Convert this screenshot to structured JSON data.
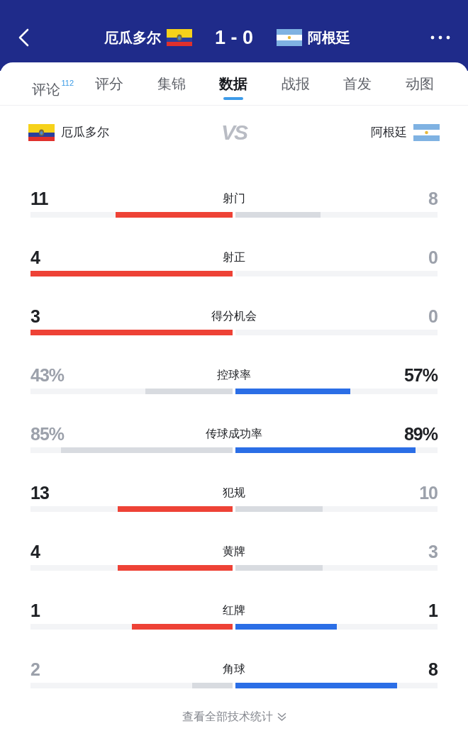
{
  "header": {
    "home_team": "厄瓜多尔",
    "score": "1 - 0",
    "away_team": "阿根廷"
  },
  "tabs": [
    {
      "label": "评论",
      "badge": "112",
      "selected": false
    },
    {
      "label": "评分",
      "selected": false
    },
    {
      "label": "集锦",
      "selected": false
    },
    {
      "label": "数据",
      "selected": true
    },
    {
      "label": "战报",
      "selected": false
    },
    {
      "label": "首发",
      "selected": false
    },
    {
      "label": "动图",
      "selected": false
    }
  ],
  "teams": {
    "home": "厄瓜多尔",
    "vs": "VS",
    "away": "阿根廷"
  },
  "stats": [
    {
      "label": "射门",
      "home": {
        "value": "11",
        "level": 0.58,
        "leading": true
      },
      "away": {
        "value": "8",
        "level": 0.42,
        "leading": false
      }
    },
    {
      "label": "射正",
      "home": {
        "value": "4",
        "level": 1,
        "leading": true
      },
      "away": {
        "value": "0",
        "leading": false
      }
    },
    {
      "label": "得分机会",
      "home": {
        "value": "3",
        "level": 1,
        "leading": true
      },
      "away": {
        "value": "0",
        "leading": false
      }
    },
    {
      "label": "控球率",
      "home": {
        "value": "43%",
        "level": 0.43,
        "leading": false
      },
      "away": {
        "value": "57%",
        "level": 0.57,
        "leading": true
      }
    },
    {
      "label": "传球成功率",
      "home": {
        "value": "85%",
        "level": 0.85,
        "leading": false
      },
      "away": {
        "value": "89%",
        "level": 0.89,
        "leading": true
      }
    },
    {
      "label": "犯规",
      "home": {
        "value": "13",
        "level": 0.57,
        "leading": true
      },
      "away": {
        "value": "10",
        "level": 0.43,
        "leading": false
      }
    },
    {
      "label": "黄牌",
      "home": {
        "value": "4",
        "level": 0.57,
        "leading": true
      },
      "away": {
        "value": "3",
        "level": 0.43,
        "leading": false
      }
    },
    {
      "label": "红牌",
      "home": {
        "value": "1",
        "level": 0.5,
        "leading": true
      },
      "away": {
        "value": "1",
        "level": 0.5,
        "leading": true
      }
    },
    {
      "label": "角球",
      "home": {
        "value": "2",
        "level": 0.2,
        "leading": false
      },
      "away": {
        "value": "8",
        "level": 0.8,
        "leading": true
      }
    }
  ],
  "footer": {
    "link": "查看全部技术统计"
  }
}
